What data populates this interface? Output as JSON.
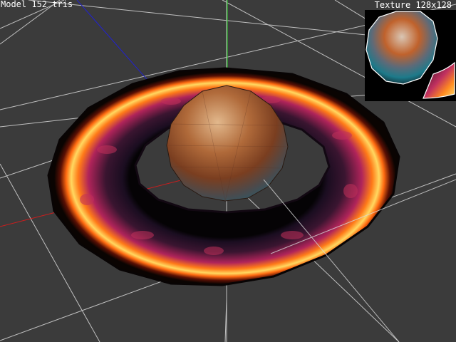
{
  "hud": {
    "model_label": "Model 152 tris",
    "texture_label": "Texture 128x128"
  },
  "colors": {
    "background": "#3b3b3b",
    "grid": "#d8d8d8",
    "x_axis": "#c81e1e",
    "y_axis": "#1ec81e",
    "z_axis": "#1e1ec8",
    "ring_outer_glow": "#ffb020",
    "ring_inner": "#1a0d1c",
    "sphere": "#9a5a32"
  },
  "icons": {
    "viewport": "3d-viewport",
    "texture": "texture-atlas-preview"
  }
}
